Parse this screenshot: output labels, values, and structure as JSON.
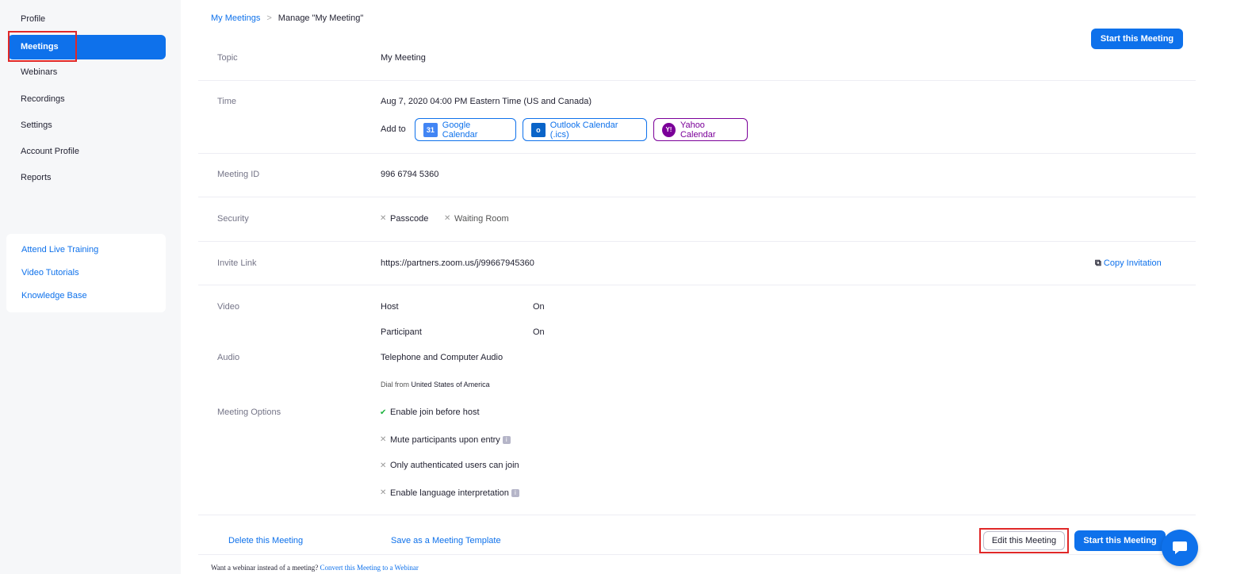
{
  "sidebar": {
    "items": [
      {
        "label": "Profile"
      },
      {
        "label": "Meetings"
      },
      {
        "label": "Webinars"
      },
      {
        "label": "Recordings"
      },
      {
        "label": "Settings"
      },
      {
        "label": "Account Profile"
      },
      {
        "label": "Reports"
      }
    ],
    "help_links": [
      {
        "label": "Attend Live Training"
      },
      {
        "label": "Video Tutorials"
      },
      {
        "label": "Knowledge Base"
      }
    ]
  },
  "breadcrumb": {
    "parent": "My Meetings",
    "separator": ">",
    "current": "Manage \"My Meeting\""
  },
  "header": {
    "start_button": "Start this Meeting"
  },
  "meeting": {
    "topic_label": "Topic",
    "topic": "My Meeting",
    "time_label": "Time",
    "time": "Aug 7, 2020 04:00 PM Eastern Time (US and Canada)",
    "add_to_label": "Add to",
    "calendars": {
      "google": {
        "icon_text": "31",
        "label": "Google Calendar"
      },
      "outlook": {
        "icon_text": "o",
        "label": "Outlook Calendar (.ics)"
      },
      "yahoo": {
        "icon_text": "Y!",
        "label": "Yahoo Calendar"
      }
    },
    "id_label": "Meeting ID",
    "id": "996 6794 5360",
    "security_label": "Security",
    "security": [
      "Passcode",
      "Waiting Room"
    ],
    "invite_label": "Invite Link",
    "invite_link": "https://partners.zoom.us/j/99667945360",
    "copy_invitation": "Copy Invitation",
    "video_label": "Video",
    "video": {
      "host_label": "Host",
      "host_value": "On",
      "participant_label": "Participant",
      "participant_value": "On"
    },
    "audio_label": "Audio",
    "audio": "Telephone and Computer Audio",
    "dial_from_prefix": "Dial from",
    "dial_from_country": "United States of America",
    "options_label": "Meeting Options",
    "options": [
      {
        "label": "Enable join before host",
        "enabled": true
      },
      {
        "label": "Mute participants upon entry",
        "enabled": false
      },
      {
        "label": "Only authenticated users can join",
        "enabled": false
      },
      {
        "label": "Enable language interpretation",
        "enabled": false
      }
    ]
  },
  "actions": {
    "delete": "Delete this Meeting",
    "save_template": "Save as a Meeting Template",
    "edit": "Edit this Meeting",
    "start": "Start this Meeting"
  },
  "footer": {
    "text": "Want a webinar instead of a meeting?",
    "link": "Convert this Meeting to a Webinar"
  },
  "colors": {
    "accent": "#0e71eb",
    "highlight": "#e02828",
    "yahoo": "#7b0099",
    "check": "#1db33f"
  }
}
